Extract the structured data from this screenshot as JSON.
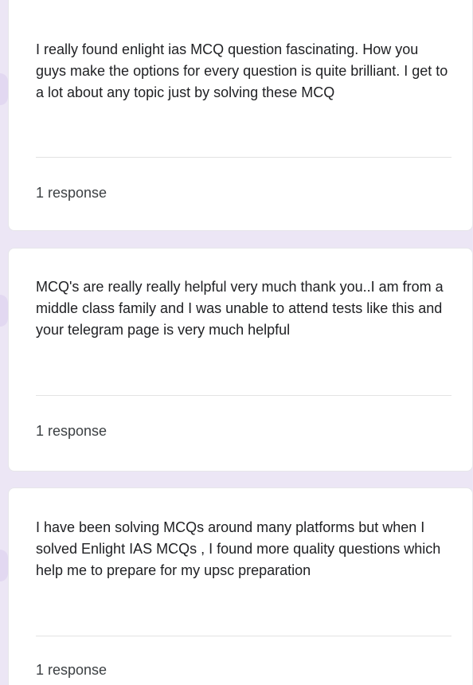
{
  "responses": [
    {
      "text": "I really found enlight ias MCQ question fascinating. How you guys make the options for every question is quite brilliant. I get to a lot about any topic just by solving these MCQ",
      "count": "1 response"
    },
    {
      "text": "MCQ's are really really helpful very much thank you..I am from a middle class family and I was unable to attend tests like this and your telegram page is very much helpful",
      "count": "1 response"
    },
    {
      "text": "I have been solving MCQs around many platforms but when I solved Enlight IAS MCQs , I found more quality questions which help me to prepare for my upsc preparation",
      "count": "1 response"
    }
  ],
  "colors": {
    "page_background": "#ece6f5",
    "card_background": "#ffffff",
    "text": "#202124"
  }
}
